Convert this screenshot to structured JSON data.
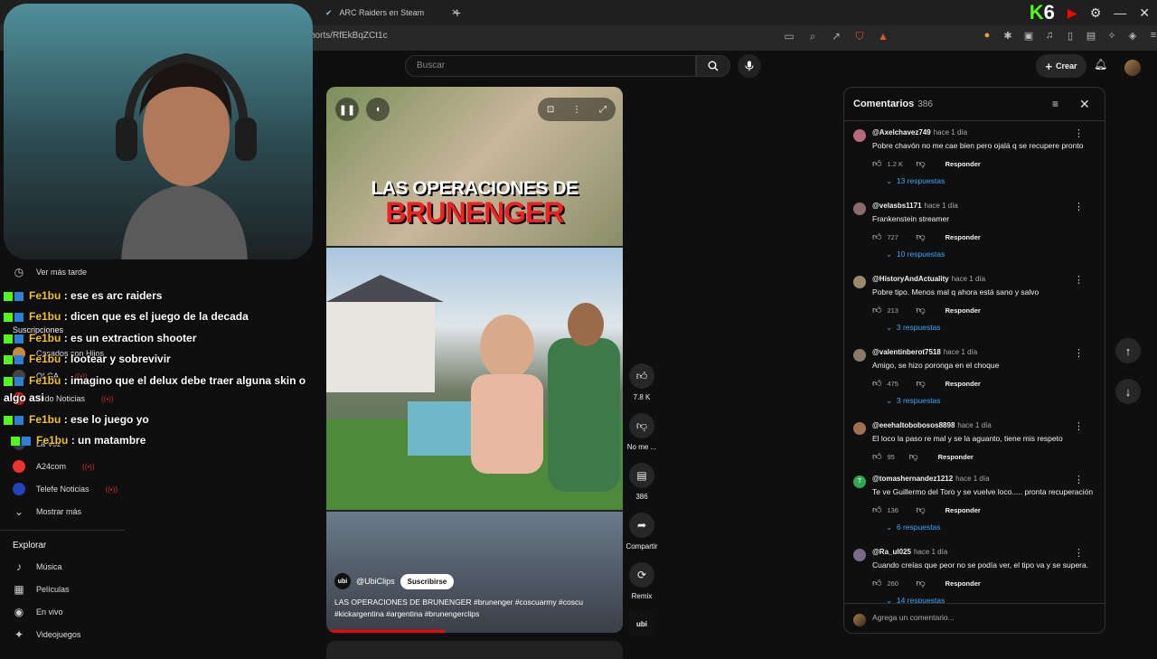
{
  "browser": {
    "tab_active_title": "ARC Raiders en Steam",
    "tab_new_symbol": "+",
    "url_partial": "horts/RfEkBqZCt1c"
  },
  "youtube": {
    "search_placeholder": "Buscar",
    "create_label": "Crear"
  },
  "sidebar": {
    "items": [
      {
        "label": "Ver más tarde",
        "icon": "clock-icon"
      }
    ],
    "subscriptions_heading": "Suscripciones",
    "channels": [
      {
        "label": "Casados con Hijos",
        "color": "#c98a3a"
      },
      {
        "label": "OLGA",
        "color": "#444"
      },
      {
        "label": "Todo Noticias",
        "color": "#d22"
      },
      {
        "label": "La Voz",
        "color": "#335"
      },
      {
        "label": "A24com",
        "color": "#e33"
      },
      {
        "label": "Telefe Noticias",
        "color": "#2244bb"
      }
    ],
    "show_more_label": "Mostrar más",
    "explore_heading": "Explorar",
    "explore_items": [
      {
        "label": "Música",
        "icon": "music-icon"
      },
      {
        "label": "Películas",
        "icon": "film-icon"
      },
      {
        "label": "En vivo",
        "icon": "live-icon"
      },
      {
        "label": "Videojuegos",
        "icon": "gamepad-icon"
      }
    ]
  },
  "stream_chat": [
    {
      "user": "Fe1bu",
      "message": ": ese es arc raiders"
    },
    {
      "user": "Fe1bu",
      "message": ": dicen que es el juego de la decada"
    },
    {
      "user": "Fe1bu",
      "message": ": es un extraction shooter"
    },
    {
      "user": "Fe1bu",
      "message": ": lootear y sobrevivir"
    },
    {
      "user": "Fe1bu",
      "message": ": imagino que el delux debe traer alguna skin o"
    },
    {
      "user": "",
      "message": "algo asi"
    },
    {
      "user": "Fe1bu",
      "message": ": ese lo juego yo"
    },
    {
      "user": "Fe1bu",
      "message": ": un matambre"
    }
  ],
  "short": {
    "title_line1": "LAS OPERACIONES DE",
    "title_line2": "BRUNENGER",
    "channel_logo_text": "ubi",
    "channel_name": "@UbiClips",
    "subscribe_label": "Suscribirse",
    "description": "LAS OPERACIONES DE BRUNENGER #brunenger #coscuarmy #coscu #kickargentina #argentina #brunengerclips",
    "progress_fraction": 0.4
  },
  "actions": {
    "like_count": "7.8 K",
    "dislike_label": "No me ...",
    "comments_count": "386",
    "share_label": "Compartir",
    "remix_label": "Remix"
  },
  "comments": {
    "title": "Comentarios",
    "count": "386",
    "input_placeholder": "Agrega un comentario...",
    "reply_label": "Responder",
    "list": [
      {
        "author": "@Axelchavez749",
        "time": "hace 1 día",
        "text": "Pobre chavón no me cae bien pero ojalá q se recupere pronto",
        "likes": "1.2 K",
        "replies": "13 respuestas",
        "color": "#b46a7a"
      },
      {
        "author": "@velasbs1171",
        "time": "hace 1 día",
        "text": "Frankenstein streamer",
        "likes": "727",
        "replies": "10 respuestas",
        "color": "#8a6a6a"
      },
      {
        "author": "@HistoryAndActuality",
        "time": "hace 1 día",
        "text": "Pobre tipo. Menos mal q ahora está sano y salvo",
        "likes": "213",
        "replies": "3 respuestas",
        "color": "#9a8a6a"
      },
      {
        "author": "@valentinberot7518",
        "time": "hace 1 día",
        "text": "Amigo, se hizo poronga en el choque",
        "likes": "475",
        "replies": "3 respuestas",
        "color": "#8a7a6a"
      },
      {
        "author": "@eeehaltobobosos8898",
        "time": "hace 1 día",
        "text": "El loco la paso re mal y se la aguanto, tiene mis respeto",
        "likes": "95",
        "replies": "",
        "color": "#a07050"
      },
      {
        "author": "@tomashernandez1212",
        "time": "hace 1 día",
        "text": "Te ve Guillermo del Toro y se vuelve loco..... pronta recuperación",
        "likes": "136",
        "replies": "6 respuestas",
        "color": "#2fa84f",
        "initial": "T"
      },
      {
        "author": "@Ra_ul025",
        "time": "hace 1 día",
        "text": "Cuando creías que peor no se podía ver, el tipo va y se supera.",
        "likes": "260",
        "replies": "14 respuestas",
        "color": "#7a6a8a"
      }
    ]
  }
}
